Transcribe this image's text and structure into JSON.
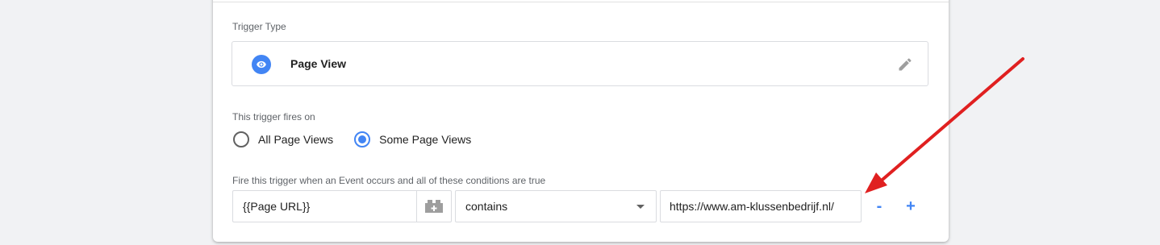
{
  "trigger_type": {
    "section_label": "Trigger Type",
    "name": "Page View",
    "icon": "eye-icon",
    "edit_icon": "pencil-icon"
  },
  "fires_on": {
    "section_label": "This trigger fires on",
    "options": [
      {
        "label": "All Page Views",
        "checked": false
      },
      {
        "label": "Some Page Views",
        "checked": true
      }
    ]
  },
  "conditions": {
    "section_label": "Fire this trigger when an Event occurs and all of these conditions are true",
    "variable": "{{Page URL}}",
    "variable_picker_icon": "variable-block-icon",
    "operator": "contains",
    "value": "https://www.am-klussenbedrijf.nl/",
    "remove_label": "-",
    "add_label": "+"
  },
  "colors": {
    "accent": "#4285f4",
    "annotation_arrow": "#e02020"
  }
}
